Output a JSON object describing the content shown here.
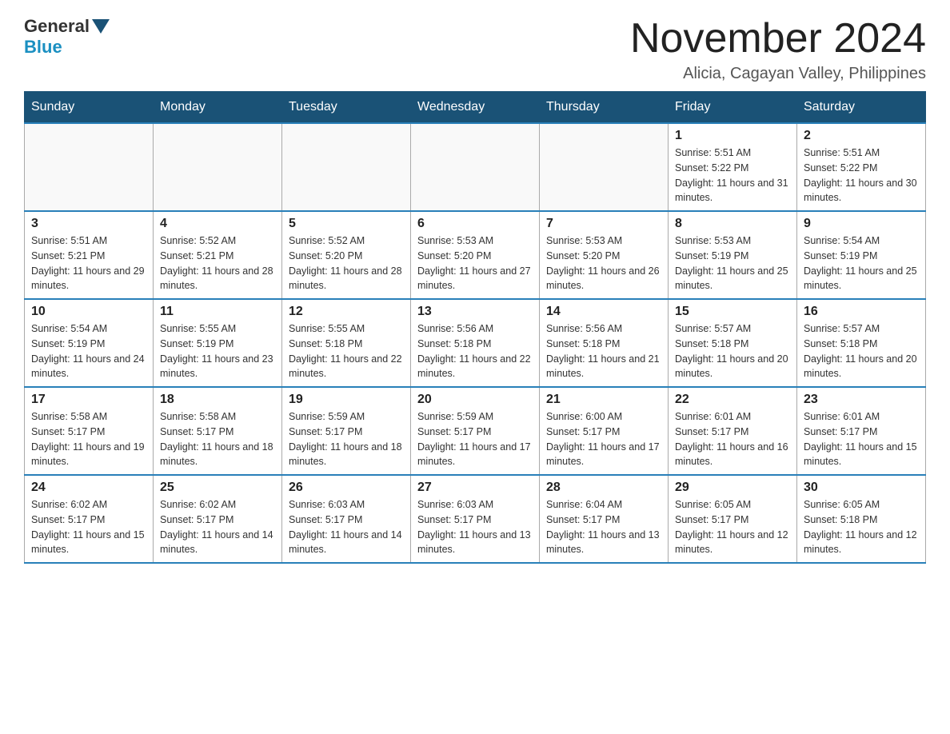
{
  "header": {
    "logo": {
      "general": "General",
      "blue": "Blue",
      "arrow": "▼"
    },
    "title": "November 2024",
    "subtitle": "Alicia, Cagayan Valley, Philippines"
  },
  "days_of_week": [
    "Sunday",
    "Monday",
    "Tuesday",
    "Wednesday",
    "Thursday",
    "Friday",
    "Saturday"
  ],
  "weeks": [
    {
      "cells": [
        {
          "day": "",
          "sunrise": "",
          "sunset": "",
          "daylight": ""
        },
        {
          "day": "",
          "sunrise": "",
          "sunset": "",
          "daylight": ""
        },
        {
          "day": "",
          "sunrise": "",
          "sunset": "",
          "daylight": ""
        },
        {
          "day": "",
          "sunrise": "",
          "sunset": "",
          "daylight": ""
        },
        {
          "day": "",
          "sunrise": "",
          "sunset": "",
          "daylight": ""
        },
        {
          "day": "1",
          "sunrise": "Sunrise: 5:51 AM",
          "sunset": "Sunset: 5:22 PM",
          "daylight": "Daylight: 11 hours and 31 minutes."
        },
        {
          "day": "2",
          "sunrise": "Sunrise: 5:51 AM",
          "sunset": "Sunset: 5:22 PM",
          "daylight": "Daylight: 11 hours and 30 minutes."
        }
      ]
    },
    {
      "cells": [
        {
          "day": "3",
          "sunrise": "Sunrise: 5:51 AM",
          "sunset": "Sunset: 5:21 PM",
          "daylight": "Daylight: 11 hours and 29 minutes."
        },
        {
          "day": "4",
          "sunrise": "Sunrise: 5:52 AM",
          "sunset": "Sunset: 5:21 PM",
          "daylight": "Daylight: 11 hours and 28 minutes."
        },
        {
          "day": "5",
          "sunrise": "Sunrise: 5:52 AM",
          "sunset": "Sunset: 5:20 PM",
          "daylight": "Daylight: 11 hours and 28 minutes."
        },
        {
          "day": "6",
          "sunrise": "Sunrise: 5:53 AM",
          "sunset": "Sunset: 5:20 PM",
          "daylight": "Daylight: 11 hours and 27 minutes."
        },
        {
          "day": "7",
          "sunrise": "Sunrise: 5:53 AM",
          "sunset": "Sunset: 5:20 PM",
          "daylight": "Daylight: 11 hours and 26 minutes."
        },
        {
          "day": "8",
          "sunrise": "Sunrise: 5:53 AM",
          "sunset": "Sunset: 5:19 PM",
          "daylight": "Daylight: 11 hours and 25 minutes."
        },
        {
          "day": "9",
          "sunrise": "Sunrise: 5:54 AM",
          "sunset": "Sunset: 5:19 PM",
          "daylight": "Daylight: 11 hours and 25 minutes."
        }
      ]
    },
    {
      "cells": [
        {
          "day": "10",
          "sunrise": "Sunrise: 5:54 AM",
          "sunset": "Sunset: 5:19 PM",
          "daylight": "Daylight: 11 hours and 24 minutes."
        },
        {
          "day": "11",
          "sunrise": "Sunrise: 5:55 AM",
          "sunset": "Sunset: 5:19 PM",
          "daylight": "Daylight: 11 hours and 23 minutes."
        },
        {
          "day": "12",
          "sunrise": "Sunrise: 5:55 AM",
          "sunset": "Sunset: 5:18 PM",
          "daylight": "Daylight: 11 hours and 22 minutes."
        },
        {
          "day": "13",
          "sunrise": "Sunrise: 5:56 AM",
          "sunset": "Sunset: 5:18 PM",
          "daylight": "Daylight: 11 hours and 22 minutes."
        },
        {
          "day": "14",
          "sunrise": "Sunrise: 5:56 AM",
          "sunset": "Sunset: 5:18 PM",
          "daylight": "Daylight: 11 hours and 21 minutes."
        },
        {
          "day": "15",
          "sunrise": "Sunrise: 5:57 AM",
          "sunset": "Sunset: 5:18 PM",
          "daylight": "Daylight: 11 hours and 20 minutes."
        },
        {
          "day": "16",
          "sunrise": "Sunrise: 5:57 AM",
          "sunset": "Sunset: 5:18 PM",
          "daylight": "Daylight: 11 hours and 20 minutes."
        }
      ]
    },
    {
      "cells": [
        {
          "day": "17",
          "sunrise": "Sunrise: 5:58 AM",
          "sunset": "Sunset: 5:17 PM",
          "daylight": "Daylight: 11 hours and 19 minutes."
        },
        {
          "day": "18",
          "sunrise": "Sunrise: 5:58 AM",
          "sunset": "Sunset: 5:17 PM",
          "daylight": "Daylight: 11 hours and 18 minutes."
        },
        {
          "day": "19",
          "sunrise": "Sunrise: 5:59 AM",
          "sunset": "Sunset: 5:17 PM",
          "daylight": "Daylight: 11 hours and 18 minutes."
        },
        {
          "day": "20",
          "sunrise": "Sunrise: 5:59 AM",
          "sunset": "Sunset: 5:17 PM",
          "daylight": "Daylight: 11 hours and 17 minutes."
        },
        {
          "day": "21",
          "sunrise": "Sunrise: 6:00 AM",
          "sunset": "Sunset: 5:17 PM",
          "daylight": "Daylight: 11 hours and 17 minutes."
        },
        {
          "day": "22",
          "sunrise": "Sunrise: 6:01 AM",
          "sunset": "Sunset: 5:17 PM",
          "daylight": "Daylight: 11 hours and 16 minutes."
        },
        {
          "day": "23",
          "sunrise": "Sunrise: 6:01 AM",
          "sunset": "Sunset: 5:17 PM",
          "daylight": "Daylight: 11 hours and 15 minutes."
        }
      ]
    },
    {
      "cells": [
        {
          "day": "24",
          "sunrise": "Sunrise: 6:02 AM",
          "sunset": "Sunset: 5:17 PM",
          "daylight": "Daylight: 11 hours and 15 minutes."
        },
        {
          "day": "25",
          "sunrise": "Sunrise: 6:02 AM",
          "sunset": "Sunset: 5:17 PM",
          "daylight": "Daylight: 11 hours and 14 minutes."
        },
        {
          "day": "26",
          "sunrise": "Sunrise: 6:03 AM",
          "sunset": "Sunset: 5:17 PM",
          "daylight": "Daylight: 11 hours and 14 minutes."
        },
        {
          "day": "27",
          "sunrise": "Sunrise: 6:03 AM",
          "sunset": "Sunset: 5:17 PM",
          "daylight": "Daylight: 11 hours and 13 minutes."
        },
        {
          "day": "28",
          "sunrise": "Sunrise: 6:04 AM",
          "sunset": "Sunset: 5:17 PM",
          "daylight": "Daylight: 11 hours and 13 minutes."
        },
        {
          "day": "29",
          "sunrise": "Sunrise: 6:05 AM",
          "sunset": "Sunset: 5:17 PM",
          "daylight": "Daylight: 11 hours and 12 minutes."
        },
        {
          "day": "30",
          "sunrise": "Sunrise: 6:05 AM",
          "sunset": "Sunset: 5:18 PM",
          "daylight": "Daylight: 11 hours and 12 minutes."
        }
      ]
    }
  ]
}
